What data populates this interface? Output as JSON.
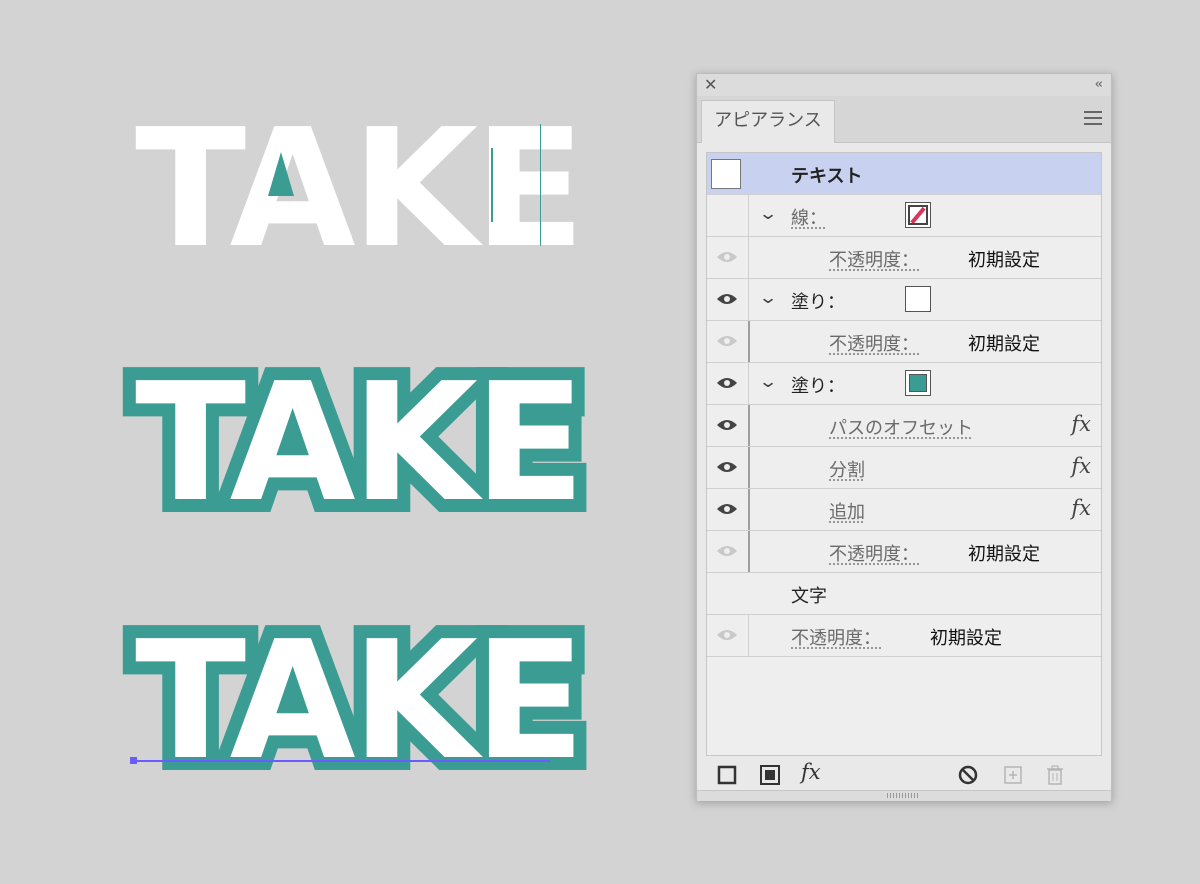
{
  "artwork": {
    "word_top": "TAKE",
    "word_middle": "TAKE",
    "word_bottom": "TAKE",
    "colors": {
      "teal": "#3b9c93",
      "text_fill": "#ffffff",
      "selection": "#6b5cff"
    }
  },
  "panel": {
    "tab_label": "アピアランス",
    "header_icons": {
      "close": "close-icon",
      "collapse": "collapse-icon",
      "menu": "menu-icon"
    },
    "rows": {
      "object": {
        "label": "テキスト"
      },
      "stroke": {
        "label": "線："
      },
      "stroke_opacity": {
        "label": "不透明度：",
        "value": "初期設定"
      },
      "fill1": {
        "label": "塗り："
      },
      "fill1_opacity": {
        "label": "不透明度：",
        "value": "初期設定"
      },
      "fill2": {
        "label": "塗り："
      },
      "effect_offset": {
        "label": "パスのオフセット",
        "fx": "fx"
      },
      "effect_divide": {
        "label": "分割",
        "fx": "fx"
      },
      "effect_add": {
        "label": "追加",
        "fx": "fx"
      },
      "fill2_opacity": {
        "label": "不透明度：",
        "value": "初期設定"
      },
      "characters": {
        "label": "文字"
      },
      "object_opacity": {
        "label": "不透明度：",
        "value": "初期設定"
      }
    },
    "footer_icons": [
      "add-stroke-icon",
      "add-fill-icon",
      "fx-icon",
      "clear-appearance-icon",
      "duplicate-item-icon",
      "delete-icon"
    ],
    "footer_fx": "fx",
    "selected_row_color": "#c8d1ef"
  }
}
